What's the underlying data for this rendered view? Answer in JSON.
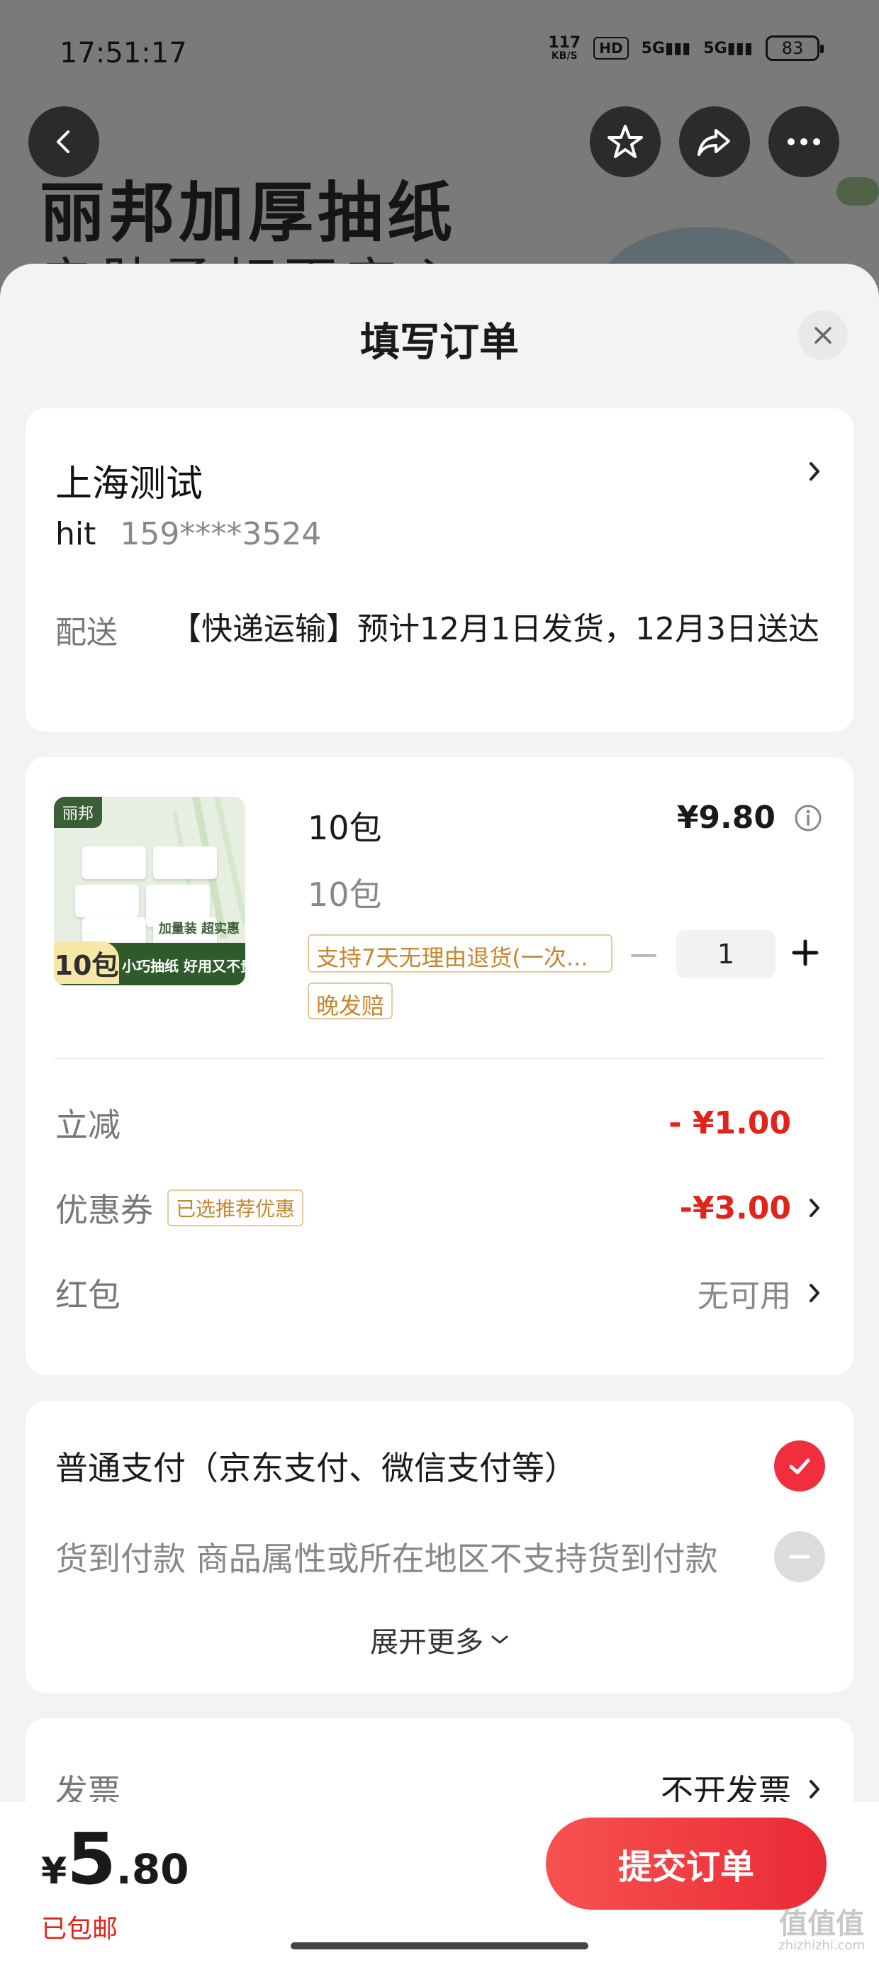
{
  "status_bar": {
    "time": "17:51:17",
    "net_speed_value": "117",
    "net_speed_unit": "KB/S",
    "hd": "HD",
    "signal_1": "5G",
    "signal_2": "5G",
    "battery": "83"
  },
  "background": {
    "title": "丽邦加厚抽纸",
    "subtitle": "亲肤柔韧更安心"
  },
  "sheet": {
    "title": "填写订单"
  },
  "address": {
    "name": "上海测试",
    "user": "hit",
    "phone": "159****3524",
    "ship_label": "配送",
    "ship_text": "【快递运输】预计12月1日发货，12月3日送达"
  },
  "product": {
    "image": {
      "brand": "丽邦",
      "count": "10包",
      "slogan": "小巧抽纸 好用又不贵",
      "tag": "加量装 超实惠"
    },
    "name": "10包",
    "spec": "10包",
    "price": "¥9.80",
    "tag_return": "支持7天无理由退货(一次...",
    "tag_late": "晚发赔",
    "quantity": "1"
  },
  "discounts": {
    "instant_label": "立减",
    "instant_value": "- ¥1.00",
    "coupon_label": "优惠券",
    "coupon_tag": "已选推荐优惠",
    "coupon_value": "-¥3.00",
    "redpack_label": "红包",
    "redpack_value": "无可用"
  },
  "payment": {
    "normal_label": "普通支付（京东支付、微信支付等）",
    "cod_label": "货到付款 商品属性或所在地区不支持货到付款",
    "expand_label": "展开更多"
  },
  "invoice": {
    "label": "发票",
    "value": "不开发票"
  },
  "bottom": {
    "currency": "¥",
    "total_int": "5",
    "total_dec": ".80",
    "ship_note": "已包邮",
    "submit_label": "提交订单"
  },
  "watermark": {
    "text": "值值值",
    "url": "zhizhizhi.com"
  },
  "colors": {
    "accent_red": "#e2231a",
    "button_red": "#f22d3d",
    "tag_orange": "#c8862e"
  }
}
